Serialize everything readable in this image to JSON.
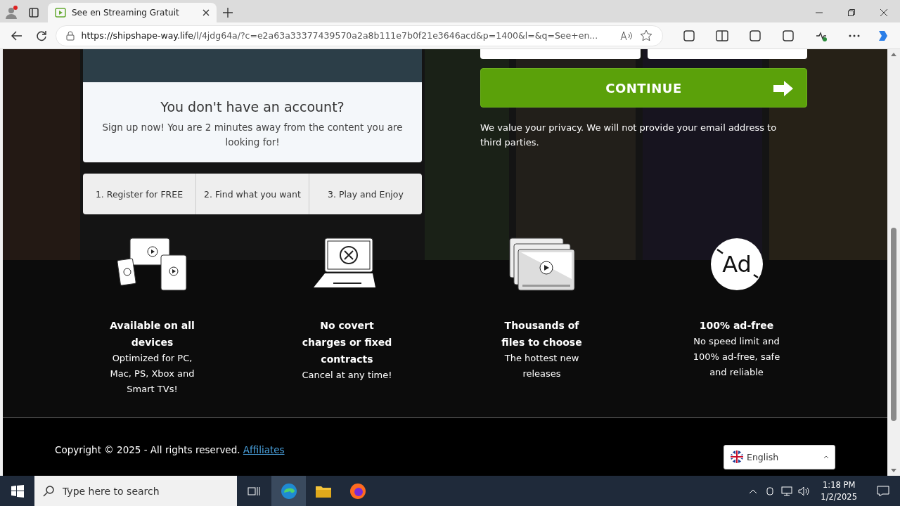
{
  "browser": {
    "tab_title": "See en Streaming Gratuit",
    "url_host": "https://shipshape-way.life",
    "url_rest": "/l/4jdg64a/?c=e2a63a33377439570a2a8b111e7b0f21e3646acd&p=1400&l=&q=See+en..."
  },
  "signup": {
    "title": "You don't have an account?",
    "text": "Sign up now! You are 2 minutes away from the content you are looking for!"
  },
  "steps": [
    "1. Register for FREE",
    "2. Find what you want",
    "3. Play and Enjoy"
  ],
  "form": {
    "button": "CONTINUE",
    "privacy": "We value your privacy. We will not provide your email address to third parties."
  },
  "features": [
    {
      "kind": "devices",
      "title": "Available on all devices",
      "text": "Optimized for PC, Mac, PS, Xbox and Smart TVs!"
    },
    {
      "kind": "laptop",
      "title": "No covert charges or fixed contracts",
      "text": "Cancel at any time!"
    },
    {
      "kind": "files",
      "title": "Thousands of files to choose",
      "text": "The hottest new releases"
    },
    {
      "kind": "adfree",
      "icon_text": "Ad",
      "title": "100% ad-free",
      "text": "No speed limit and 100% ad-free, safe and reliable"
    }
  ],
  "footer": {
    "copyright": "Copyright © 2025 - All rights reserved.",
    "link": "Affiliates",
    "language": "English"
  },
  "taskbar": {
    "search_placeholder": "Type here to search",
    "time": "1:18 PM",
    "date": "1/2/2025"
  }
}
